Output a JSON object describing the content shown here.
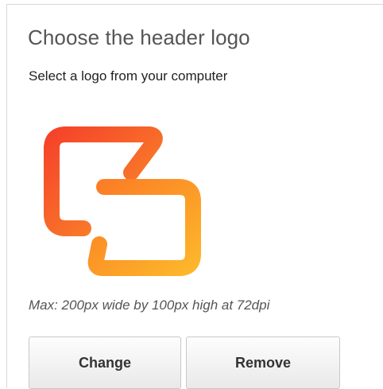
{
  "panel": {
    "title": "Choose the header logo",
    "subtitle": "Select a logo from your computer",
    "hint": "Max: 200px wide by 100px high at 72dpi"
  },
  "logo": {
    "icon": "linked-rectangles-logo-icon",
    "colors": {
      "gradient_start": "#f5432a",
      "gradient_end": "#fdb62a"
    }
  },
  "buttons": {
    "change_label": "Change",
    "remove_label": "Remove"
  }
}
